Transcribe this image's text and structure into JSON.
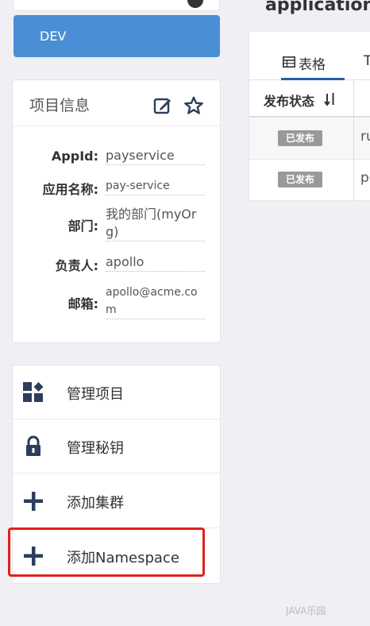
{
  "env": {
    "label": "DEV"
  },
  "info_panel": {
    "title": "项目信息",
    "rows": [
      {
        "label": "AppId:",
        "value": "payservice"
      },
      {
        "label": "应用名称:",
        "value": "pay-service"
      },
      {
        "label": "部门:",
        "value": "我的部门(myOrg)"
      },
      {
        "label": "负责人:",
        "value": "apollo"
      },
      {
        "label": "邮箱:",
        "value": "apollo@acme.com"
      }
    ]
  },
  "menu": {
    "items": [
      {
        "label": "管理项目",
        "icon": "grid-diamond-icon"
      },
      {
        "label": "管理秘钥",
        "icon": "lock-icon"
      },
      {
        "label": "添加集群",
        "icon": "plus-icon"
      },
      {
        "label": "添加Namespace",
        "icon": "plus-icon"
      }
    ]
  },
  "namespace": {
    "title": "application",
    "tabs": [
      {
        "label": "表格",
        "icon": "table-icon"
      },
      {
        "label": "T"
      }
    ],
    "table": {
      "header_status": "发布状态",
      "rows": [
        {
          "status": "已发布",
          "value": "ru"
        },
        {
          "status": "已发布",
          "value": "pc"
        }
      ]
    }
  },
  "watermark": "JAVA乐园",
  "colors": {
    "env_button": "#4a8fd6",
    "highlight": "#e0201b",
    "tab_active": "#2a5ea8",
    "badge": "#999999",
    "icon": "#2c3e5c"
  }
}
